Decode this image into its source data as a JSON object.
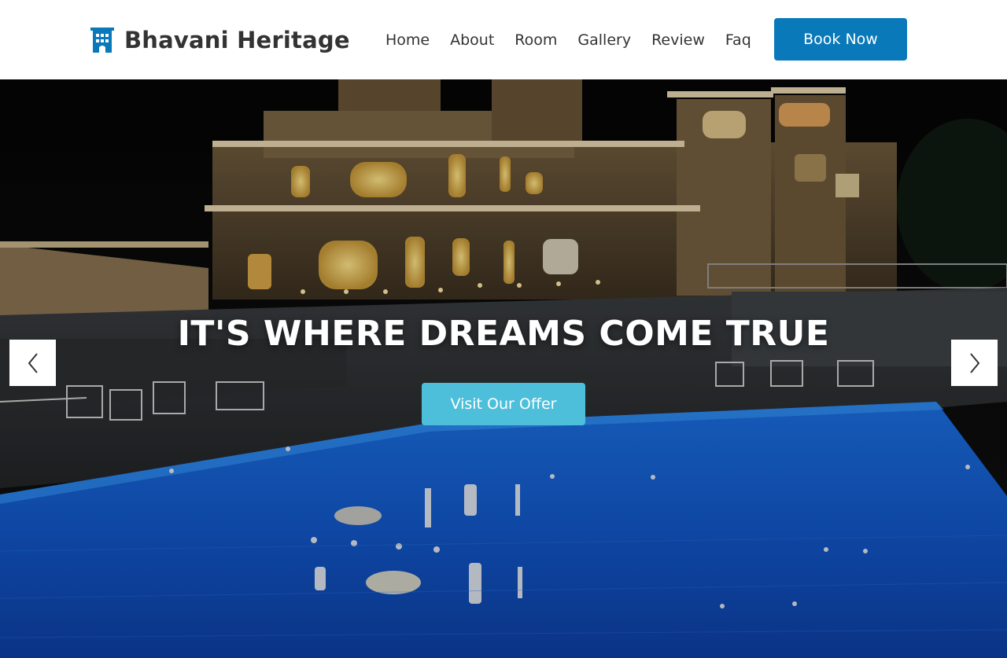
{
  "brand": {
    "name": "Bhavani Heritage",
    "icon": "building-icon",
    "color": "#0a79b9"
  },
  "nav": {
    "items": [
      {
        "label": "Home"
      },
      {
        "label": "About"
      },
      {
        "label": "Room"
      },
      {
        "label": "Gallery"
      },
      {
        "label": "Review"
      },
      {
        "label": "Faq"
      }
    ],
    "cta_label": "Book Now",
    "cta_color": "#0a79b9"
  },
  "hero": {
    "title": "IT'S WHERE DREAMS COME TRUE",
    "button_label": "Visit Our Offer",
    "button_color": "#4dbfda",
    "prev_icon": "chevron-left-icon",
    "next_icon": "chevron-right-icon",
    "background": "palace-pool-night-photo"
  }
}
